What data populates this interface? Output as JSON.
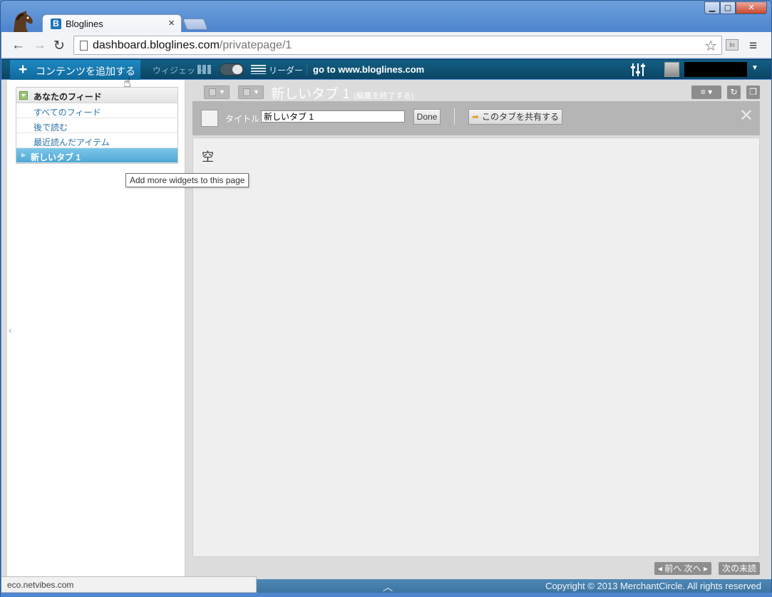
{
  "browser": {
    "tab_title": "Bloglines",
    "tab_favicon": "B",
    "tab_close": "×",
    "url_host": "dashboard.bloglines.com",
    "url_path": "/privatepage/1",
    "ext_label": "In",
    "window_controls": {
      "min": "▁",
      "max": "▢",
      "close": "✕"
    },
    "status_url": "eco.netvibes.com"
  },
  "appbar": {
    "add_content_label": "コンテンツを追加する",
    "widget_label": "ウィジェット",
    "reader_label": "リーダー",
    "goto_link": "go to www.bloglines.com"
  },
  "sidebar": {
    "feeds_title": "あなたのフィード",
    "items": [
      "すべてのフィード",
      "後で読む",
      "最近読んだアイテム"
    ],
    "active_item": "新しいタブ 1"
  },
  "tooltip": "Add more widgets to this page",
  "main": {
    "tab_name": "新しいタブ 1",
    "tab_edit_note": "(編集を終了する)",
    "edit": {
      "title_label": "タイトル:",
      "title_value": "新しいタブ 1",
      "done_label": "Done",
      "share_label": "このタブを共有する"
    },
    "empty_label": "空",
    "pager": {
      "prev": "前へ",
      "next": "次へ",
      "next_unread": "次の未読"
    }
  },
  "footer": {
    "copyright": "Copyright © 2013 MerchantCircle. All rights reserved"
  },
  "colors": {
    "appbar": "#0b4564",
    "accent": "#1478ac",
    "active_feed": "#62b8e0"
  }
}
